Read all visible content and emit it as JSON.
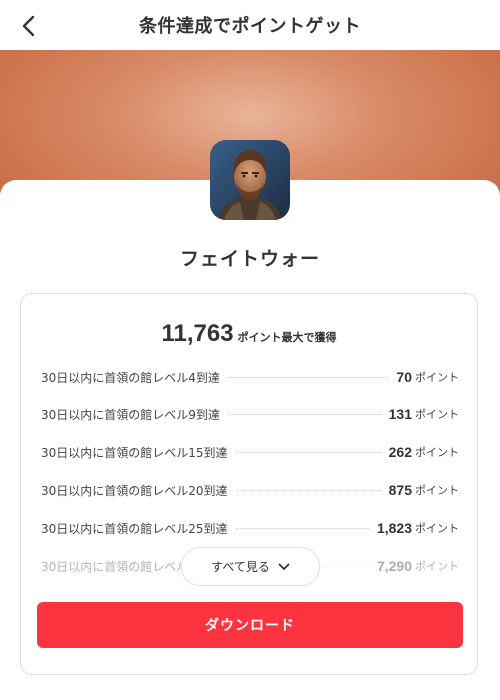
{
  "header": {
    "title": "条件達成でポイントゲット"
  },
  "app": {
    "name": "フェイトウォー"
  },
  "total": {
    "value": "11,763",
    "label": "ポイント最大で獲得"
  },
  "tasks": [
    {
      "name": "30日以内に首領の館レベル4到達",
      "points": "70",
      "unit": "ポイント"
    },
    {
      "name": "30日以内に首領の館レベル9到達",
      "points": "131",
      "unit": "ポイント"
    },
    {
      "name": "30日以内に首領の館レベル15到達",
      "points": "262",
      "unit": "ポイント"
    },
    {
      "name": "30日以内に首領の館レベル20到達",
      "points": "875",
      "unit": "ポイント"
    },
    {
      "name": "30日以内に首領の館レベル25到達",
      "points": "1,823",
      "unit": "ポイント"
    },
    {
      "name": "30日以内に首領の館レベル",
      "points": "7,290",
      "unit": "ポイント"
    }
  ],
  "see_all": {
    "label": "すべて見る"
  },
  "download": {
    "label": "ダウンロード"
  },
  "colors": {
    "accent": "#fd3440",
    "hero": "#d88a66"
  },
  "icons": {
    "back": "chevron-left-icon",
    "see_all": "chevron-down-icon"
  }
}
